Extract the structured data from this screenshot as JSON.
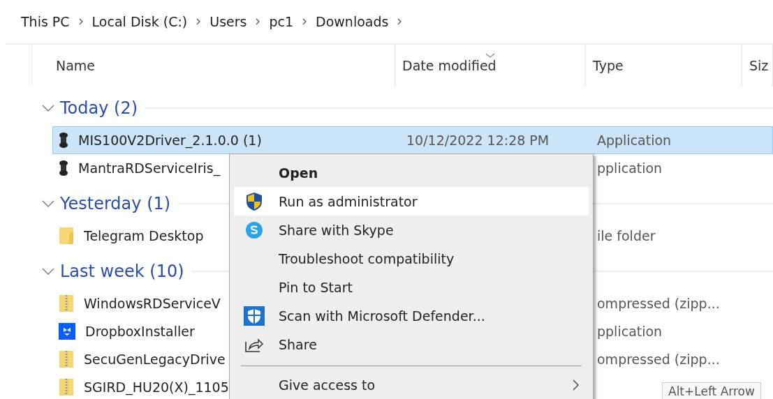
{
  "breadcrumb": [
    "This PC",
    "Local Disk (C:)",
    "Users",
    "pc1",
    "Downloads"
  ],
  "columns": [
    {
      "label": "Name",
      "sorted": false
    },
    {
      "label": "Date modified",
      "sorted": true
    },
    {
      "label": "Type",
      "sorted": false
    },
    {
      "label": "Siz",
      "sorted": false
    }
  ],
  "groups": [
    {
      "label": "Today (2)",
      "expanded": true,
      "items": [
        {
          "name": "MIS100V2Driver_2.1.0.0 (1)",
          "date": "10/12/2022 12:28 PM",
          "type": "Application",
          "kind": "device",
          "selected": true
        },
        {
          "name": "MantraRDServiceIris_",
          "type": "pplication",
          "kind": "device",
          "selected": false
        }
      ]
    },
    {
      "label": "Yesterday (1)",
      "expanded": true,
      "items": [
        {
          "name": "Telegram Desktop",
          "type": "ile folder",
          "kind": "folder",
          "selected": false
        }
      ]
    },
    {
      "label": "Last week (10)",
      "expanded": true,
      "items": [
        {
          "name": "WindowsRDServiceV",
          "type": "ompressed (zipp...",
          "kind": "zip",
          "selected": false
        },
        {
          "name": "DropboxInstaller",
          "type": "pplication",
          "kind": "dropbox",
          "selected": false
        },
        {
          "name": "SecuGenLegacyDrive",
          "type": "ompressed (zipp...",
          "kind": "zip",
          "selected": false
        },
        {
          "name": "SGIRD_HU20(X)_1105",
          "kind": "zip",
          "selected": false
        }
      ]
    }
  ],
  "context_menu": {
    "items": [
      {
        "label": "Open",
        "kind": "plain",
        "bold": true,
        "highlighted": false
      },
      {
        "label": "Run as administrator",
        "kind": "shield",
        "bold": false,
        "highlighted": true
      },
      {
        "label": "Share with Skype",
        "kind": "skype",
        "bold": false,
        "highlighted": false
      },
      {
        "label": "Troubleshoot compatibility",
        "kind": "plain",
        "bold": false,
        "highlighted": false
      },
      {
        "label": "Pin to Start",
        "kind": "plain",
        "bold": false,
        "highlighted": false
      },
      {
        "label": "Scan with Microsoft Defender...",
        "kind": "defender",
        "bold": false,
        "highlighted": false
      },
      {
        "label": "Share",
        "kind": "share",
        "bold": false,
        "highlighted": false
      },
      {
        "label": "Give access to",
        "kind": "plain",
        "bold": false,
        "highlighted": false,
        "separator_before": true,
        "submenu": true
      }
    ]
  },
  "tooltip": "Alt+Left Arrow"
}
